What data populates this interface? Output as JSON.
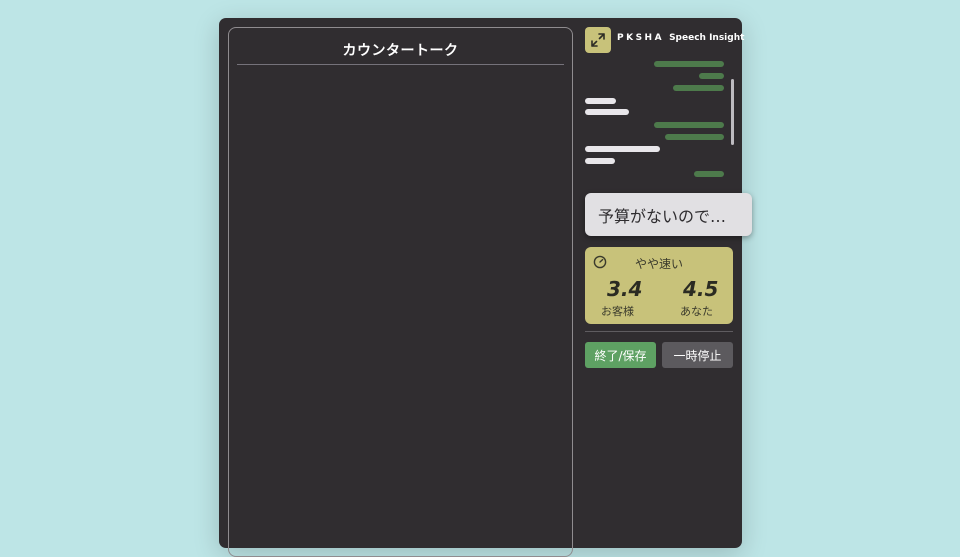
{
  "counter_panel": {
    "title": "カウンタートーク"
  },
  "header": {
    "brand_mark": "PKSHA",
    "brand_product": "Speech Insight",
    "expand_icon": "expand-arrows-icon"
  },
  "transcript": {
    "lines": [
      {
        "speaker": "agent"
      },
      {
        "speaker": "agent"
      },
      {
        "speaker": "agent"
      },
      {
        "speaker": "customer"
      },
      {
        "speaker": "customer"
      },
      {
        "speaker": "agent"
      },
      {
        "speaker": "agent"
      },
      {
        "speaker": "customer"
      },
      {
        "speaker": "customer"
      },
      {
        "speaker": "agent"
      }
    ]
  },
  "suggestion": {
    "text": "予算がないので…"
  },
  "speed": {
    "icon": "speedometer-icon",
    "label": "やや速い",
    "customer_value": "3.4",
    "customer_label": "お客様",
    "you_value": "4.5",
    "you_label": "あなた"
  },
  "actions": {
    "end_save": "終了/保存",
    "pause": "一時停止"
  },
  "colors": {
    "background": "#bde5e6",
    "panel": "#302d30",
    "accent": "#c8c27a",
    "agent_line": "#4d7a4b",
    "customer_line": "#e8e6ea",
    "end_button": "#5ea163",
    "pause_button": "#5c5a5e"
  }
}
